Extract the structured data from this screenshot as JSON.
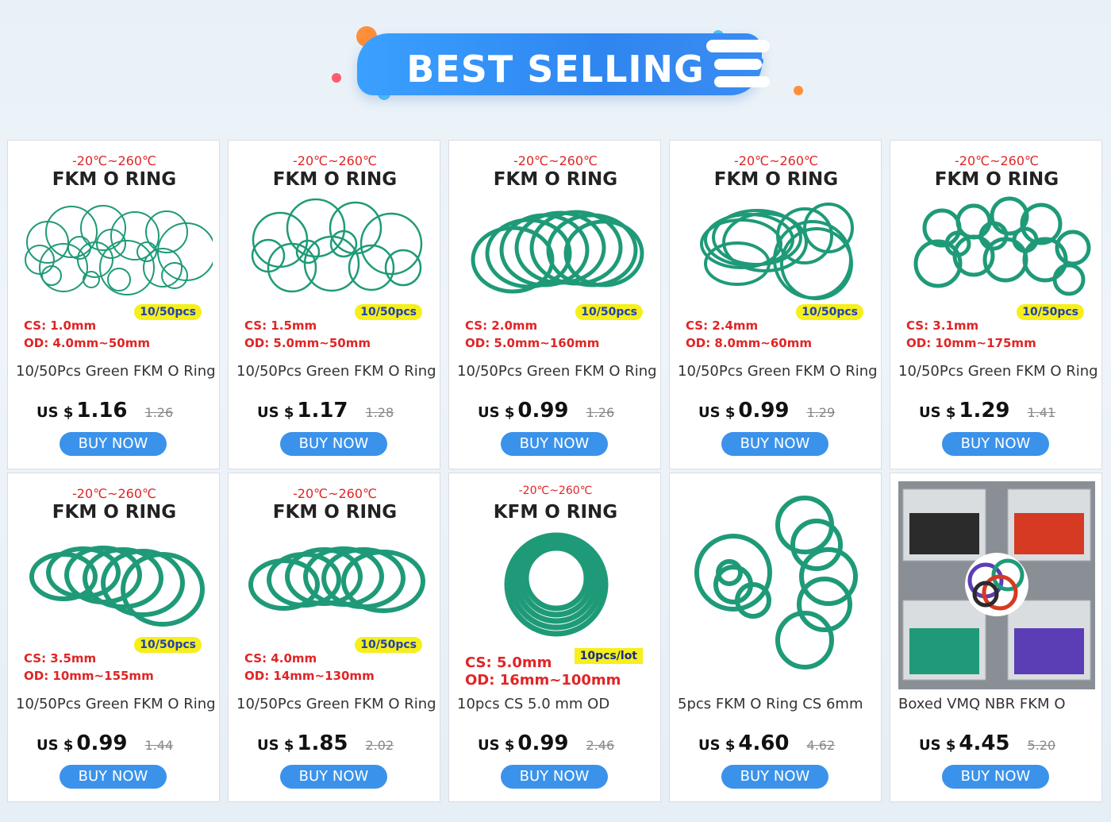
{
  "banner": {
    "title": "BEST SELLING"
  },
  "colors": {
    "accent": "#3b92ea",
    "ring_green": "#1f9a78",
    "temp_red": "#e02525",
    "badge_yellow": "#f6ef1a"
  },
  "products": [
    {
      "temp": "-20℃~260℃",
      "ring_title": "FKM O RING",
      "cs": "CS: 1.0mm",
      "od": "OD: 4.0mm~50mm",
      "badge": "10/50pcs",
      "title": "10/50Pcs Green FKM O Ring",
      "currency": "US $",
      "price": "1.16",
      "old_price": "1.26",
      "buy": "BUY NOW"
    },
    {
      "temp": "-20℃~260℃",
      "ring_title": "FKM O RING",
      "cs": "CS: 1.5mm",
      "od": "OD: 5.0mm~50mm",
      "badge": "10/50pcs",
      "title": "10/50Pcs Green FKM O Ring",
      "currency": "US $",
      "price": "1.17",
      "old_price": "1.28",
      "buy": "BUY NOW"
    },
    {
      "temp": "-20℃~260℃",
      "ring_title": "FKM O RING",
      "cs": "CS: 2.0mm",
      "od": "OD: 5.0mm~160mm",
      "badge": "10/50pcs",
      "title": "10/50Pcs Green FKM O Ring",
      "currency": "US $",
      "price": "0.99",
      "old_price": "1.26",
      "buy": "BUY NOW"
    },
    {
      "temp": "-20℃~260℃",
      "ring_title": "FKM O RING",
      "cs": "CS: 2.4mm",
      "od": "OD: 8.0mm~60mm",
      "badge": "10/50pcs",
      "title": "10/50Pcs Green FKM O Ring",
      "currency": "US $",
      "price": "0.99",
      "old_price": "1.29",
      "buy": "BUY NOW"
    },
    {
      "temp": "-20℃~260℃",
      "ring_title": "FKM O RING",
      "cs": "CS: 3.1mm",
      "od": "OD: 10mm~175mm",
      "badge": "10/50pcs",
      "title": "10/50Pcs Green FKM O Ring",
      "currency": "US $",
      "price": "1.29",
      "old_price": "1.41",
      "buy": "BUY NOW"
    },
    {
      "temp": "-20℃~260℃",
      "ring_title": "FKM O RING",
      "cs": "CS: 3.5mm",
      "od": "OD: 10mm~155mm",
      "badge": "10/50pcs",
      "title": "10/50Pcs Green FKM O Ring",
      "currency": "US $",
      "price": "0.99",
      "old_price": "1.44",
      "buy": "BUY NOW"
    },
    {
      "temp": "-20℃~260℃",
      "ring_title": "FKM O RING",
      "cs": "CS: 4.0mm",
      "od": "OD: 14mm~130mm",
      "badge": "10/50pcs",
      "title": "10/50Pcs Green FKM O Ring",
      "currency": "US $",
      "price": "1.85",
      "old_price": "2.02",
      "buy": "BUY NOW"
    },
    {
      "temp": "-20℃~260℃",
      "ring_title": "KFM O RING",
      "cs": "CS:  5.0mm",
      "od": "OD: 16mm~100mm",
      "badge": "10pcs/lot",
      "title": "10pcs CS 5.0 mm OD",
      "currency": "US $",
      "price": "0.99",
      "old_price": "2.46",
      "buy": "BUY NOW"
    },
    {
      "temp": "",
      "ring_title": "",
      "cs": "",
      "od": "",
      "badge": "",
      "title": "5pcs FKM O Ring CS 6mm",
      "currency": "US $",
      "price": "4.60",
      "old_price": "4.62",
      "buy": "BUY NOW"
    },
    {
      "temp": "",
      "ring_title": "",
      "cs": "",
      "od": "",
      "badge": "",
      "title": "Boxed VMQ NBR FKM O",
      "currency": "US $",
      "price": "4.45",
      "old_price": "5.20",
      "buy": "BUY NOW"
    }
  ]
}
